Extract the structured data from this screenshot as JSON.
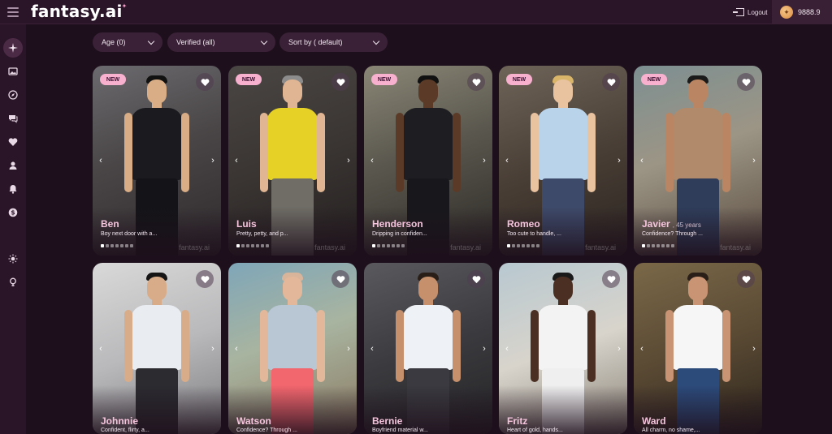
{
  "header": {
    "logo": "fantasy.ai",
    "logout_label": "Logout",
    "credits": "9888.9"
  },
  "sidebar": {
    "items": [
      {
        "icon": "sparkle-icon"
      },
      {
        "icon": "gallery-icon"
      },
      {
        "icon": "compass-icon"
      },
      {
        "icon": "chat-icon"
      },
      {
        "icon": "heart-icon"
      },
      {
        "icon": "user-icon"
      },
      {
        "icon": "bell-icon"
      },
      {
        "icon": "dollar-icon"
      },
      {
        "icon": "sun-icon"
      },
      {
        "icon": "lightbulb-icon"
      }
    ]
  },
  "filters": {
    "age": "Age (0)",
    "verified": "Verified (all)",
    "sort": "Sort by ( default)"
  },
  "new_label": "NEW",
  "watermark": "fantasy.ai",
  "cards": [
    {
      "name": "Ben",
      "age": "",
      "desc": "Boy next door with a...",
      "new": true
    },
    {
      "name": "Luis",
      "age": "",
      "desc": "Pretty, petty, and p...",
      "new": true
    },
    {
      "name": "Henderson",
      "age": "",
      "desc": "Dripping in confiden...",
      "new": true
    },
    {
      "name": "Romeo",
      "age": "",
      "desc": "Too cute to handle, ...",
      "new": true
    },
    {
      "name": "Javier",
      "age": ", 45 years",
      "desc": "Confidence? Through ...",
      "new": true
    },
    {
      "name": "Johnnie",
      "age": "",
      "desc": "Confident, flirty, a...",
      "new": false
    },
    {
      "name": "Watson",
      "age": "",
      "desc": "Confidence? Through ...",
      "new": false
    },
    {
      "name": "Bernie",
      "age": "",
      "desc": "Boyfriend material w...",
      "new": false
    },
    {
      "name": "Fritz",
      "age": "",
      "desc": "Heart of gold, hands...",
      "new": false
    },
    {
      "name": "Ward",
      "age": "",
      "desc": "All charm, no shame,...",
      "new": false
    }
  ],
  "colors": {
    "background": "#1e0f1c",
    "accent_pink": "#f7b1cf",
    "name_pink": "#f6c4dd"
  }
}
